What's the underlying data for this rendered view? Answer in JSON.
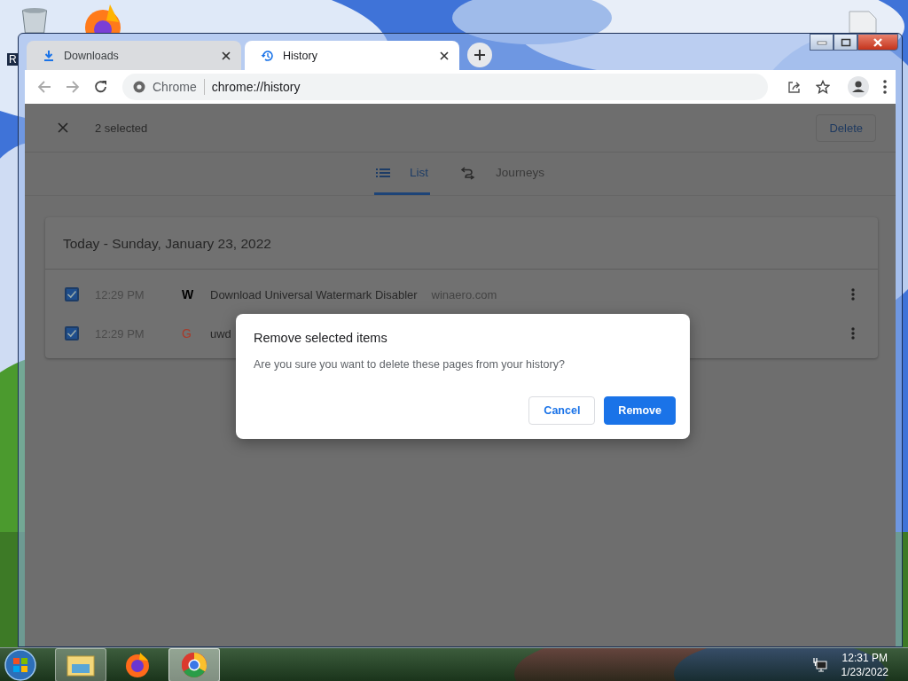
{
  "desktop": {
    "partial_label": "R"
  },
  "tabs": [
    {
      "label": "Downloads",
      "selected": false,
      "kind": "download"
    },
    {
      "label": "History",
      "selected": true,
      "kind": "history"
    }
  ],
  "address": {
    "site_label": "Chrome",
    "url": "chrome://history"
  },
  "selection_bar": {
    "count_text": "2 selected",
    "delete_button": "Delete"
  },
  "view_tabs": [
    {
      "label": "List",
      "selected": true,
      "kind": "list"
    },
    {
      "label": "Journeys",
      "selected": false,
      "kind": "journeys"
    }
  ],
  "history": {
    "date_heading": "Today - Sunday, January 23, 2022",
    "entries": [
      {
        "checked": true,
        "time": "12:29 PM",
        "favicon": "W",
        "kind": "plain",
        "title": "Download Universal Watermark Disabler",
        "domain": "winaero.com"
      },
      {
        "checked": true,
        "time": "12:29 PM",
        "favicon": "G",
        "kind": "google",
        "title": "uwd"
      }
    ]
  },
  "dialog": {
    "title": "Remove selected items",
    "message": "Are you sure you want to delete these pages from your history?",
    "buttons": [
      {
        "label": "Cancel",
        "kind": "secondary"
      },
      {
        "label": "Remove",
        "kind": "primary"
      }
    ]
  },
  "taskbar": {
    "apps": [
      {
        "kind": "explorer",
        "selected": false
      },
      {
        "kind": "firefox",
        "selected": false
      },
      {
        "kind": "chrome",
        "selected": true
      }
    ],
    "clock": {
      "time": "12:31 PM",
      "date": "1/23/2022"
    }
  }
}
